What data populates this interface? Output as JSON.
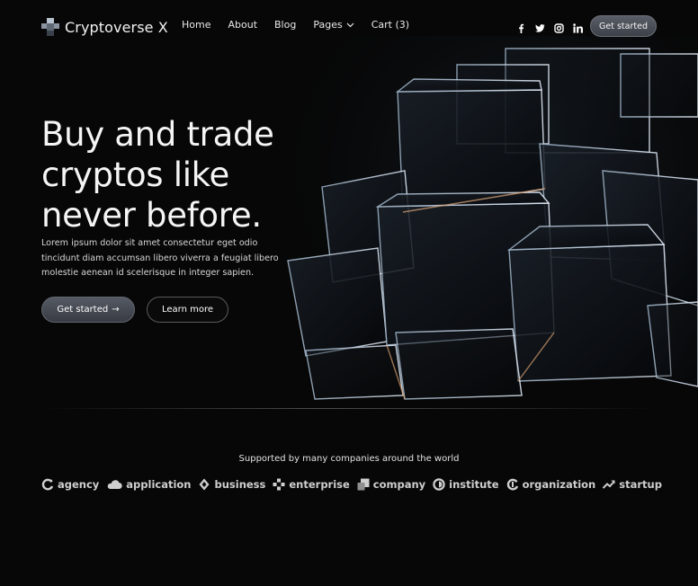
{
  "brand": {
    "name": "Cryptoverse X"
  },
  "nav": {
    "items": [
      {
        "label": "Home"
      },
      {
        "label": "About"
      },
      {
        "label": "Blog"
      },
      {
        "label": "Pages"
      },
      {
        "label": "Cart (3)"
      }
    ],
    "socials": [
      "facebook-icon",
      "twitter-icon",
      "instagram-icon",
      "linkedin-icon"
    ],
    "cta": "Get started"
  },
  "hero": {
    "headline": "Buy and trade cryptos like never before.",
    "lead": "Lorem ipsum dolor sit amet consectetur eget odio tincidunt diam accumsan libero viverra a feugiat libero molestie aenean id scelerisque in integer sapien.",
    "primary_cta": "Get started",
    "primary_cta_icon": "→",
    "secondary_cta": "Learn more"
  },
  "partners": {
    "heading": "Supported by many companies around the world",
    "logos": [
      {
        "name": "agency",
        "icon": "ring-c-icon"
      },
      {
        "name": "application",
        "icon": "cloud-icon"
      },
      {
        "name": "business",
        "icon": "diamond-icon"
      },
      {
        "name": "enterprise",
        "icon": "cross-icon"
      },
      {
        "name": "company",
        "icon": "squares-icon"
      },
      {
        "name": "institute",
        "icon": "half-circle-icon"
      },
      {
        "name": "organization",
        "icon": "ring-c-icon"
      },
      {
        "name": "startup",
        "icon": "trend-up-icon"
      }
    ]
  },
  "colors": {
    "background": "#070707",
    "button": "#4a4e57",
    "text": "#f5f5f5"
  }
}
